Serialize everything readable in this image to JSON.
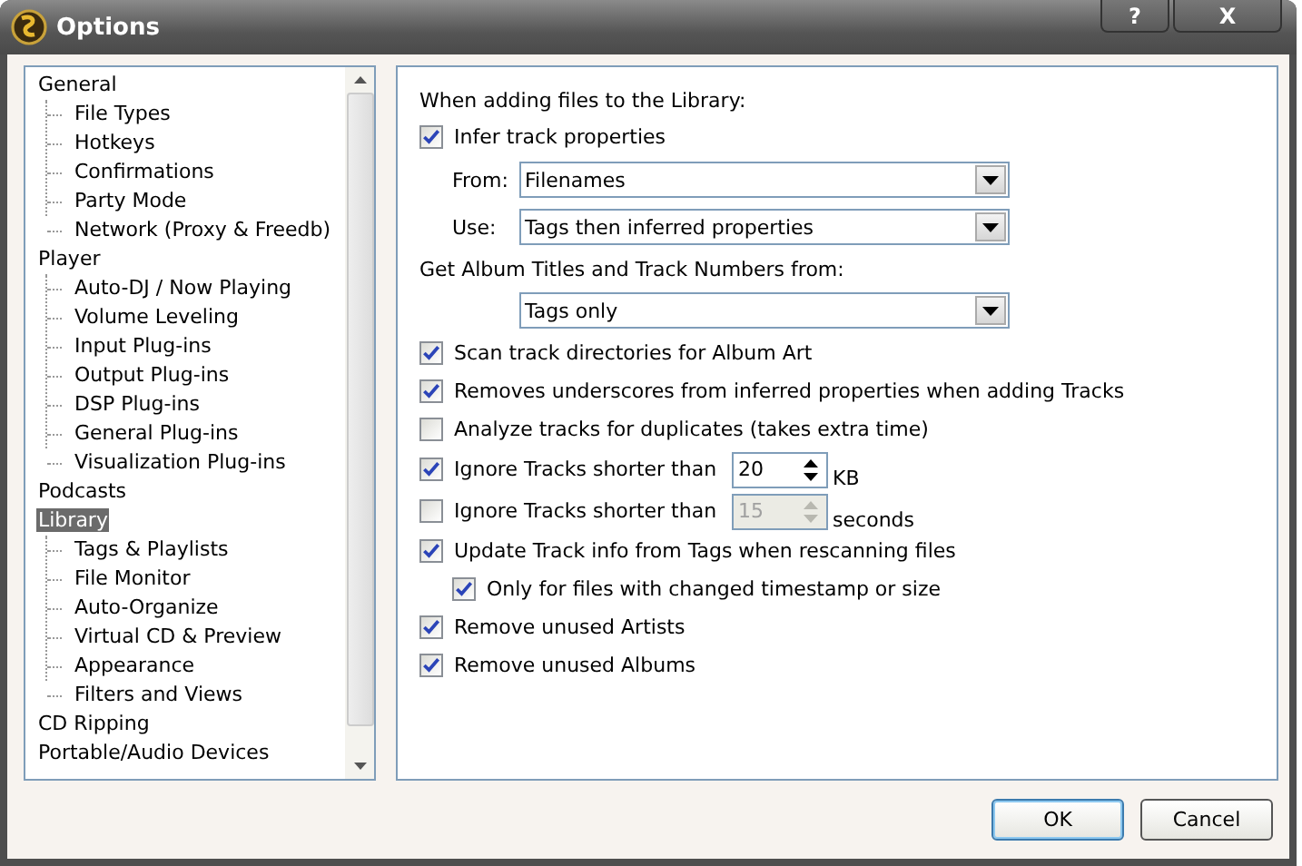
{
  "window": {
    "title": "Options",
    "help_button": "?",
    "close_button": "X"
  },
  "tree": [
    {
      "label": "General",
      "selected": false,
      "children": [
        {
          "label": "File Types",
          "selected": false
        },
        {
          "label": "Hotkeys",
          "selected": false
        },
        {
          "label": "Confirmations",
          "selected": false
        },
        {
          "label": "Party Mode",
          "selected": false
        },
        {
          "label": "Network (Proxy & Freedb)",
          "selected": false
        }
      ]
    },
    {
      "label": "Player",
      "selected": false,
      "children": [
        {
          "label": "Auto-DJ / Now Playing",
          "selected": false
        },
        {
          "label": "Volume Leveling",
          "selected": false
        },
        {
          "label": "Input Plug-ins",
          "selected": false
        },
        {
          "label": "Output Plug-ins",
          "selected": false
        },
        {
          "label": "DSP Plug-ins",
          "selected": false
        },
        {
          "label": "General Plug-ins",
          "selected": false
        },
        {
          "label": "Visualization Plug-ins",
          "selected": false
        }
      ]
    },
    {
      "label": "Podcasts",
      "selected": false
    },
    {
      "label": "Library",
      "selected": true,
      "children": [
        {
          "label": "Tags & Playlists",
          "selected": false
        },
        {
          "label": "File Monitor",
          "selected": false
        },
        {
          "label": "Auto-Organize",
          "selected": false
        },
        {
          "label": "Virtual CD & Preview",
          "selected": false
        },
        {
          "label": "Appearance",
          "selected": false
        },
        {
          "label": "Filters and Views",
          "selected": false
        }
      ]
    },
    {
      "label": "CD Ripping",
      "selected": false
    },
    {
      "label": "Portable/Audio Devices",
      "selected": false
    }
  ],
  "settings": [
    {
      "kind": "heading",
      "label": "When adding files to the Library:"
    },
    {
      "kind": "checkbox",
      "label": "Infer track properties",
      "checked": true,
      "children": [
        {
          "kind": "dropdown",
          "label": "From:",
          "value": "Filenames"
        },
        {
          "kind": "dropdown",
          "label": "Use:",
          "value": "Tags then inferred properties"
        }
      ]
    },
    {
      "kind": "heading",
      "label": "Get Album Titles and Track Numbers from:"
    },
    {
      "kind": "dropdown",
      "value": "Tags only"
    },
    {
      "kind": "checkbox",
      "label": "Scan track directories for Album Art",
      "checked": true
    },
    {
      "kind": "checkbox",
      "label": "Removes underscores from inferred properties when adding Tracks",
      "checked": true
    },
    {
      "kind": "checkbox",
      "label": "Analyze tracks for duplicates (takes extra time)",
      "checked": false
    },
    {
      "kind": "spinner",
      "label": "Ignore Tracks shorter than",
      "checked": true,
      "value": "20",
      "unit": "KB",
      "disabled": false
    },
    {
      "kind": "spinner",
      "label": "Ignore Tracks shorter than",
      "checked": false,
      "value": "15",
      "unit": "seconds",
      "disabled": true
    },
    {
      "kind": "checkbox",
      "label": "Update Track info from Tags when rescanning files",
      "checked": true,
      "children": [
        {
          "kind": "checkbox",
          "label": "Only for files with changed timestamp or size",
          "checked": true
        }
      ]
    },
    {
      "kind": "checkbox",
      "label": "Remove unused Artists",
      "checked": true
    },
    {
      "kind": "checkbox",
      "label": "Remove unused Albums",
      "checked": true
    }
  ],
  "buttons": [
    {
      "label": "OK",
      "default": true
    },
    {
      "label": "Cancel",
      "default": false
    }
  ]
}
